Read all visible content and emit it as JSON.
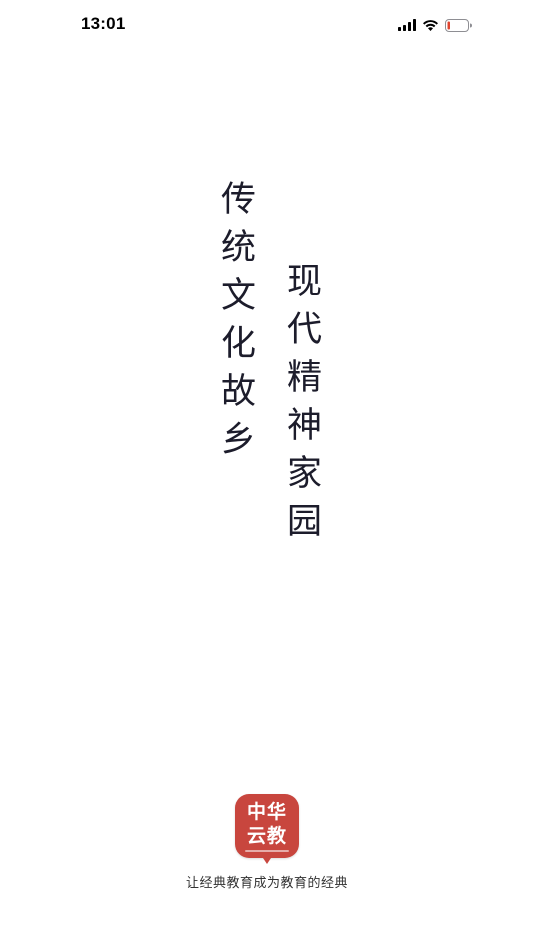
{
  "status_bar": {
    "time": "13:01",
    "icons": [
      "signal-icon",
      "wifi-icon",
      "battery-icon"
    ],
    "battery_color": "#e0442f"
  },
  "splash": {
    "poem_left": "传统文化故乡",
    "poem_right": "现代精神家园"
  },
  "logo": {
    "line1": "中华",
    "line2": "云教",
    "color": "#c8463e"
  },
  "slogan": "让经典教育成为教育的经典"
}
